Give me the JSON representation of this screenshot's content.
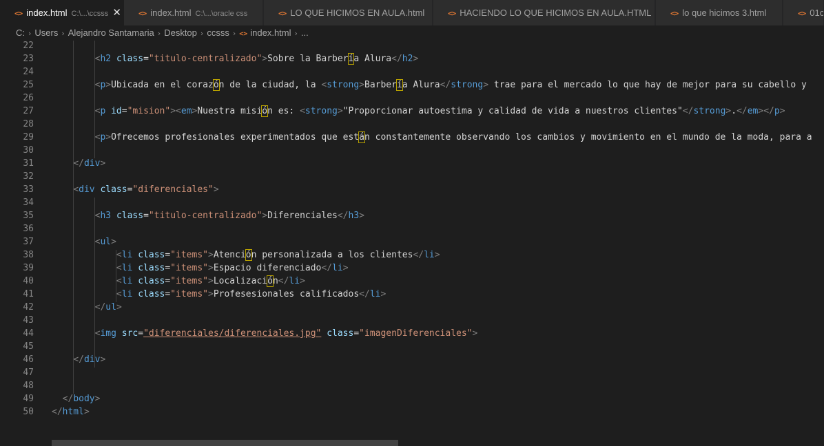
{
  "tabs": [
    {
      "label": "index.html",
      "description": "C:\\...\\ccsss",
      "close": "✕",
      "active": true
    },
    {
      "label": "index.html",
      "description": "C:\\...\\oracle css",
      "active": false
    },
    {
      "label": "LO QUE HICIMOS EN AULA.html",
      "description": "",
      "active": false
    },
    {
      "label": "HACIENDO LO QUE HICIMOS EN AULA.HTML",
      "description": "",
      "active": false
    },
    {
      "label": "lo que hicimos 3.html",
      "description": "",
      "active": false
    },
    {
      "label": "01c",
      "description": "",
      "active": false
    }
  ],
  "tab_icon": "<>",
  "breadcrumb": {
    "items": [
      "C:",
      "Users",
      "Alejandro Santamaria",
      "Desktop",
      "ccsss",
      "index.html",
      "..."
    ],
    "separator": "›"
  },
  "editor": {
    "lines": [
      {
        "num": "22",
        "code": ""
      },
      {
        "num": "23",
        "code": "        <h2 class=\"titulo-centralizado\">Sobre la Barbería Alura</h2>"
      },
      {
        "num": "24",
        "code": ""
      },
      {
        "num": "25",
        "code": "        <p>Ubicada en el corazón de la ciudad, la <strong>Barbería Alura</strong> trae para el mercado lo que hay de mejor para su cabello y"
      },
      {
        "num": "26",
        "code": ""
      },
      {
        "num": "27",
        "code": "        <p id=\"mision\"><em>Nuestra misión es: <strong>\"Proporcionar autoestima y calidad de vida a nuestros clientes\"</strong>.</em></p>"
      },
      {
        "num": "28",
        "code": ""
      },
      {
        "num": "29",
        "code": "        <p>Ofrecemos profesionales experimentados que están constantemente observando los cambios y movimiento en el mundo de la moda, para a"
      },
      {
        "num": "30",
        "code": ""
      },
      {
        "num": "31",
        "code": "    </div>"
      },
      {
        "num": "32",
        "code": ""
      },
      {
        "num": "33",
        "code": "    <div class=\"diferenciales\">"
      },
      {
        "num": "34",
        "code": ""
      },
      {
        "num": "35",
        "code": "        <h3 class=\"titulo-centralizado\">Diferenciales</h3>"
      },
      {
        "num": "36",
        "code": ""
      },
      {
        "num": "37",
        "code": "        <ul>"
      },
      {
        "num": "38",
        "code": "            <li class=\"items\">Atención personalizada a los clientes</li>"
      },
      {
        "num": "39",
        "code": "            <li class=\"items\">Espacio diferenciado</li>"
      },
      {
        "num": "40",
        "code": "            <li class=\"items\">Localización</li>"
      },
      {
        "num": "41",
        "code": "            <li class=\"items\">Profesesionales calificados</li>"
      },
      {
        "num": "42",
        "code": "        </ul>"
      },
      {
        "num": "43",
        "code": ""
      },
      {
        "num": "44",
        "code": "        <img src=\"diferenciales/diferenciales.jpg\" class=\"imagenDiferenciales\">"
      },
      {
        "num": "45",
        "code": ""
      },
      {
        "num": "46",
        "code": "    </div>"
      },
      {
        "num": "47",
        "code": ""
      },
      {
        "num": "48",
        "code": ""
      },
      {
        "num": "49",
        "code": "  </body>"
      },
      {
        "num": "50",
        "code": "</html>"
      }
    ]
  },
  "colors": {
    "tag": "#569cd6",
    "bracket": "#808080",
    "attribute": "#9cdcfe",
    "string": "#ce9178",
    "text": "#d4d4d4",
    "line_number": "#858585",
    "tab_icon": "#e37933"
  }
}
